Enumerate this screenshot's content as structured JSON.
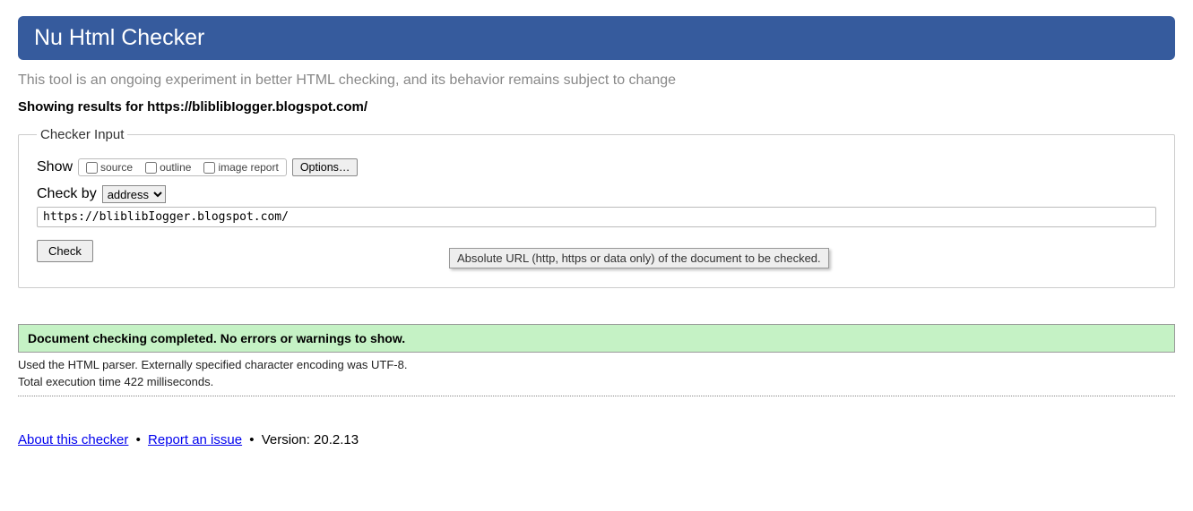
{
  "banner": {
    "title": "Nu Html Checker"
  },
  "intro": "This tool is an ongoing experiment in better HTML checking, and its behavior remains subject to change",
  "heading": "Showing results for https://bliblibIogger.blogspot.com/",
  "checker": {
    "legend": "Checker Input",
    "show_label": "Show",
    "source_label": "source",
    "outline_label": "outline",
    "image_report_label": "image report",
    "options_button": "Options…",
    "check_by_label": "Check by",
    "check_by_selected": "address",
    "url_value": "https://bliblibIogger.blogspot.com/",
    "tooltip": "Absolute URL (http, https or data only) of the document to be checked.",
    "check_button": "Check"
  },
  "result": {
    "success": "Document checking completed. No errors or warnings to show.",
    "parser_line": "Used the HTML parser. Externally specified character encoding was UTF-8.",
    "time_line": "Total execution time 422 milliseconds."
  },
  "footer": {
    "about_link": "About this checker",
    "report_link": "Report an issue",
    "version_label": "Version: 20.2.13"
  }
}
